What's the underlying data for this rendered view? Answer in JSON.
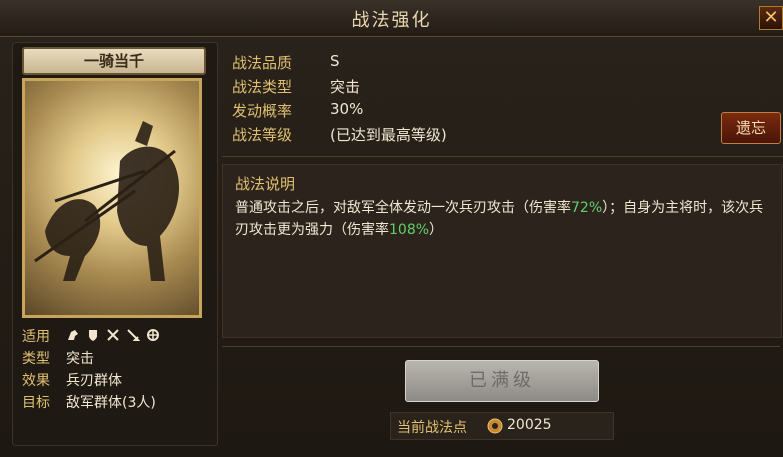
{
  "window": {
    "title": "战法强化",
    "close_label": "✕"
  },
  "skill": {
    "name": "一骑当千",
    "stats": [
      {
        "label": "适用",
        "value": ""
      },
      {
        "label": "类型",
        "value": "突击"
      },
      {
        "label": "效果",
        "value": "兵刃群体"
      },
      {
        "label": "目标",
        "value": "敌军群体(3人)"
      }
    ],
    "troop_icons": [
      "cavalry-icon",
      "shield-icon",
      "bow-icon",
      "spear-icon",
      "siege-icon"
    ]
  },
  "details": {
    "rows": [
      {
        "label": "战法品质",
        "value": "S"
      },
      {
        "label": "战法类型",
        "value": "突击"
      },
      {
        "label": "发动概率",
        "value": "30%"
      },
      {
        "label": "战法等级",
        "value": "(已达到最高等级)"
      }
    ],
    "forget_label": "遗忘"
  },
  "description": {
    "title": "战法说明",
    "part1": "普通攻击之后，对敌军全体发动一次兵刃攻击（伤害率",
    "rate1": "72%",
    "part2": "）；自身为主将时，该次兵刃攻击更为强力（伤害率",
    "rate2": "108%",
    "part3": "）"
  },
  "action": {
    "max_label": "已满级"
  },
  "points": {
    "label": "当前战法点",
    "value": "20025"
  },
  "colors": {
    "gold": "#e0c070",
    "highlight": "#5fd06a",
    "panel": "#2c241c"
  }
}
